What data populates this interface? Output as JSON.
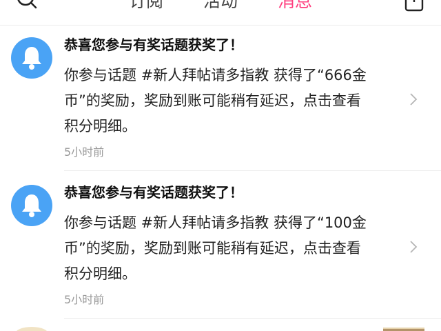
{
  "tabs": [
    {
      "label": "订阅"
    },
    {
      "label": "活动"
    },
    {
      "label": "消息"
    }
  ],
  "active_tab": "消息",
  "colors": {
    "accent": "#ff3f7f",
    "avatar_bg": "#4aa3f5",
    "time_text": "#999999"
  },
  "notifications": [
    {
      "icon": "bell-icon",
      "title": "恭喜您参与有奖话题获奖了！",
      "body_line1": "你参与话题 #新人拜帖请多指教 获得了“666金",
      "body_line2": "币”的奖励，奖励到账可能稍有延迟，点击查看",
      "body_line3": "积分明细。",
      "time": "5小时前"
    },
    {
      "icon": "bell-icon",
      "title": "恭喜您参与有奖话题获奖了！",
      "body_line1": "你参与话题 #新人拜帖请多指教 获得了“100金",
      "body_line2": "币”的奖励，奖励到账可能稍有延迟，点击查看",
      "body_line3": "积分明细。",
      "time": "5小时前"
    }
  ]
}
